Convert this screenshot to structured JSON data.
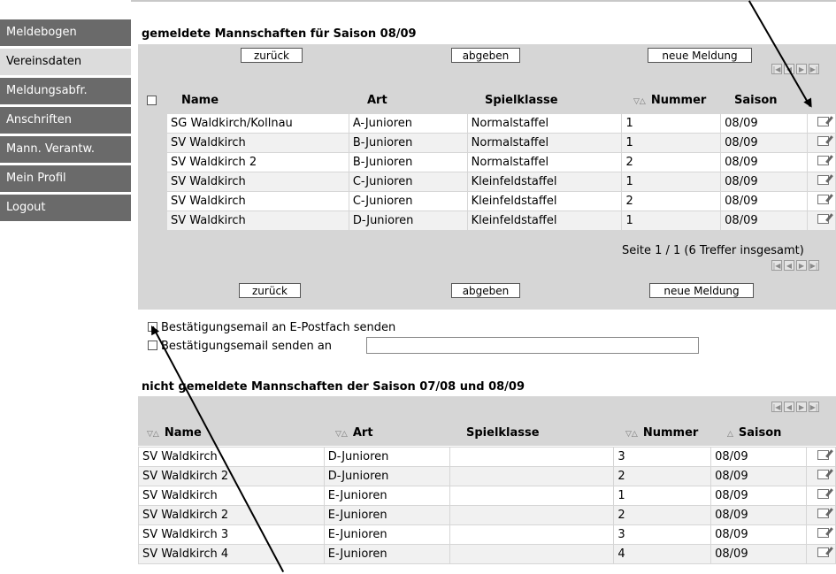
{
  "sidebar": {
    "items": [
      "Meldebogen",
      "Vereinsdaten",
      "Meldungsabfr.",
      "Anschriften",
      "Mann. Verantw.",
      "Mein Profil",
      "Logout"
    ],
    "active_index": 1
  },
  "reported": {
    "title": "gemeldete Mannschaften für Saison 08/09",
    "buttons": {
      "back": "zurück",
      "submit": "abgeben",
      "new": "neue Meldung"
    },
    "columns": {
      "name": "Name",
      "art": "Art",
      "spielklasse": "Spielklasse",
      "nummer": "Nummer",
      "saison": "Saison"
    },
    "sort_mark": "▽△",
    "rows": [
      [
        "SG Waldkirch/Kollnau",
        "A-Junioren",
        "Normalstaffel",
        "1",
        "08/09"
      ],
      [
        "SV Waldkirch",
        "B-Junioren",
        "Normalstaffel",
        "1",
        "08/09"
      ],
      [
        "SV Waldkirch 2",
        "B-Junioren",
        "Normalstaffel",
        "2",
        "08/09"
      ],
      [
        "SV Waldkirch",
        "C-Junioren",
        "Kleinfeldstaffel",
        "1",
        "08/09"
      ],
      [
        "SV Waldkirch",
        "C-Junioren",
        "Kleinfeldstaffel",
        "2",
        "08/09"
      ],
      [
        "SV Waldkirch",
        "D-Junioren",
        "Kleinfeldstaffel",
        "1",
        "08/09"
      ]
    ],
    "page_info": "Seite 1 / 1 (6 Treffer insgesamt)"
  },
  "confirm": {
    "mailbox_label": "Bestätigungsemail an E-Postfach senden",
    "send_to_label": "Bestätigungsemail senden an",
    "email_value": ""
  },
  "unreported": {
    "title": "nicht gemeldete Mannschaften der Saison 07/08 und 08/09",
    "columns": {
      "name": "Name",
      "art": "Art",
      "spielklasse": "Spielklasse",
      "nummer": "Nummer",
      "saison": "Saison"
    },
    "sort_mark": "▽△",
    "asc_mark": "△",
    "rows": [
      [
        "SV Waldkirch",
        "D-Junioren",
        "",
        "3",
        "08/09"
      ],
      [
        "SV Waldkirch 2",
        "D-Junioren",
        "",
        "2",
        "08/09"
      ],
      [
        "SV Waldkirch",
        "E-Junioren",
        "",
        "1",
        "08/09"
      ],
      [
        "SV Waldkirch 2",
        "E-Junioren",
        "",
        "2",
        "08/09"
      ],
      [
        "SV Waldkirch 3",
        "E-Junioren",
        "",
        "3",
        "08/09"
      ],
      [
        "SV Waldkirch 4",
        "E-Junioren",
        "",
        "4",
        "08/09"
      ]
    ]
  },
  "icons": {
    "edit": "edit-icon",
    "first": "first-page-icon",
    "prev": "prev-page-icon",
    "next": "next-page-icon",
    "last": "last-page-icon"
  },
  "pager_glyphs": [
    "|◀",
    "◀",
    "▶",
    "▶|"
  ]
}
